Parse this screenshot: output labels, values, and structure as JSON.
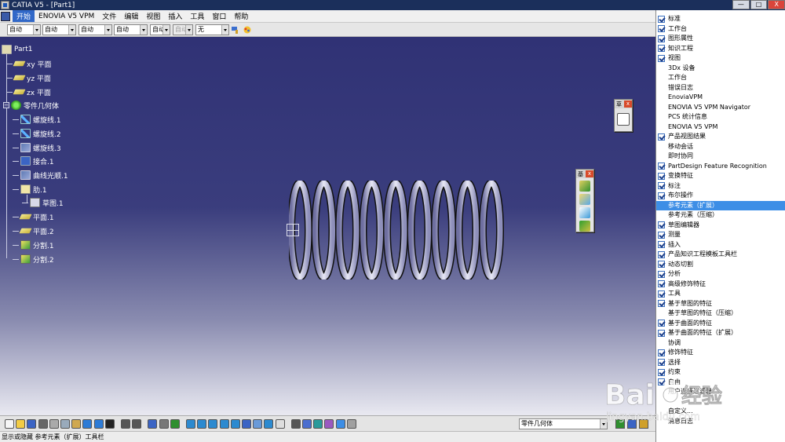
{
  "window": {
    "title": "CATIA V5 - [Part1]",
    "controls": [
      "—",
      "□",
      "X"
    ]
  },
  "menubar": {
    "items": [
      "开始",
      "ENOVIA V5 VPM",
      "文件",
      "编辑",
      "视图",
      "插入",
      "工具",
      "窗口",
      "帮助"
    ]
  },
  "format_toolbar": {
    "combos": [
      "自动",
      "自动",
      "自动",
      "自动",
      "自动",
      "自动",
      "无"
    ]
  },
  "spec_tree": {
    "root": "Part1",
    "planes": [
      "xy 平面",
      "yz 平面",
      "zx 平面"
    ],
    "body": "零件几何体",
    "features": [
      "螺旋线.1",
      "螺旋线.2",
      "螺旋线.3",
      "接合.1",
      "曲线光顺.1",
      "肋.1",
      "草图.1",
      "平面.1",
      "平面.2",
      "分割.1",
      "分割.2"
    ]
  },
  "floating_toolbars": {
    "tb1_title": "草",
    "tb2_title": "基"
  },
  "context_menu": {
    "items": [
      {
        "label": "标准",
        "checked": true
      },
      {
        "label": "工作台",
        "checked": true
      },
      {
        "label": "图形属性",
        "checked": true
      },
      {
        "label": "知识工程",
        "checked": true
      },
      {
        "label": "视图",
        "checked": true
      },
      {
        "label": "3Dx 设备",
        "checked": false
      },
      {
        "label": "工作台",
        "checked": false
      },
      {
        "label": "错误日志",
        "checked": false
      },
      {
        "label": "EnoviaVPM",
        "checked": false
      },
      {
        "label": "ENOVIA V5 VPM Navigator",
        "checked": false
      },
      {
        "label": "PCS 统计信息",
        "checked": false
      },
      {
        "label": "ENOVIA V5 VPM",
        "checked": false
      },
      {
        "label": "产品视图结果",
        "checked": true
      },
      {
        "label": "移动会话",
        "checked": false
      },
      {
        "label": "即时协同",
        "checked": false
      },
      {
        "label": "PartDesign Feature Recognition",
        "checked": true
      },
      {
        "label": "变换特征",
        "checked": true
      },
      {
        "label": "标注",
        "checked": true
      },
      {
        "label": "布尔操作",
        "checked": true
      },
      {
        "label": "参考元素（扩展）",
        "checked": false,
        "highlighted": true
      },
      {
        "label": "参考元素（压缩）",
        "checked": false
      },
      {
        "label": "草图编辑器",
        "checked": true
      },
      {
        "label": "测量",
        "checked": true
      },
      {
        "label": "插入",
        "checked": true
      },
      {
        "label": "产品知识工程模板工具栏",
        "checked": true
      },
      {
        "label": "动态切割",
        "checked": true
      },
      {
        "label": "分析",
        "checked": true
      },
      {
        "label": "高级修饰特征",
        "checked": true
      },
      {
        "label": "工具",
        "checked": true
      },
      {
        "label": "基于草图的特征",
        "checked": true
      },
      {
        "label": "基于草图的特征（压缩）",
        "checked": false
      },
      {
        "label": "基于曲面的特征",
        "checked": true
      },
      {
        "label": "基于曲面的特征（扩展）",
        "checked": true
      },
      {
        "label": "协调",
        "checked": false
      },
      {
        "label": "修饰特征",
        "checked": true
      },
      {
        "label": "选择",
        "checked": true
      },
      {
        "label": "约束",
        "checked": true
      },
      {
        "label": "自由",
        "checked": true
      },
      {
        "label": "用户选择过滤器",
        "checked": false
      },
      {
        "label": "",
        "checked": false
      },
      {
        "label": "自定义...",
        "checked": false
      },
      {
        "label": "消息日志",
        "checked": false
      }
    ]
  },
  "bottom_toolbar": {
    "body_combo": "零件几何体"
  },
  "status_bar": {
    "text": "显示或隐藏 参考元素（扩展）工具栏"
  },
  "watermark": {
    "brand": "Bai",
    "brand_cn": "经验",
    "url": "jingyan.baidu.com"
  },
  "colors": {
    "viewport_top": "#303275",
    "menu_highlight": "#3d8ee6",
    "titlebar": "#1b2f5b"
  }
}
